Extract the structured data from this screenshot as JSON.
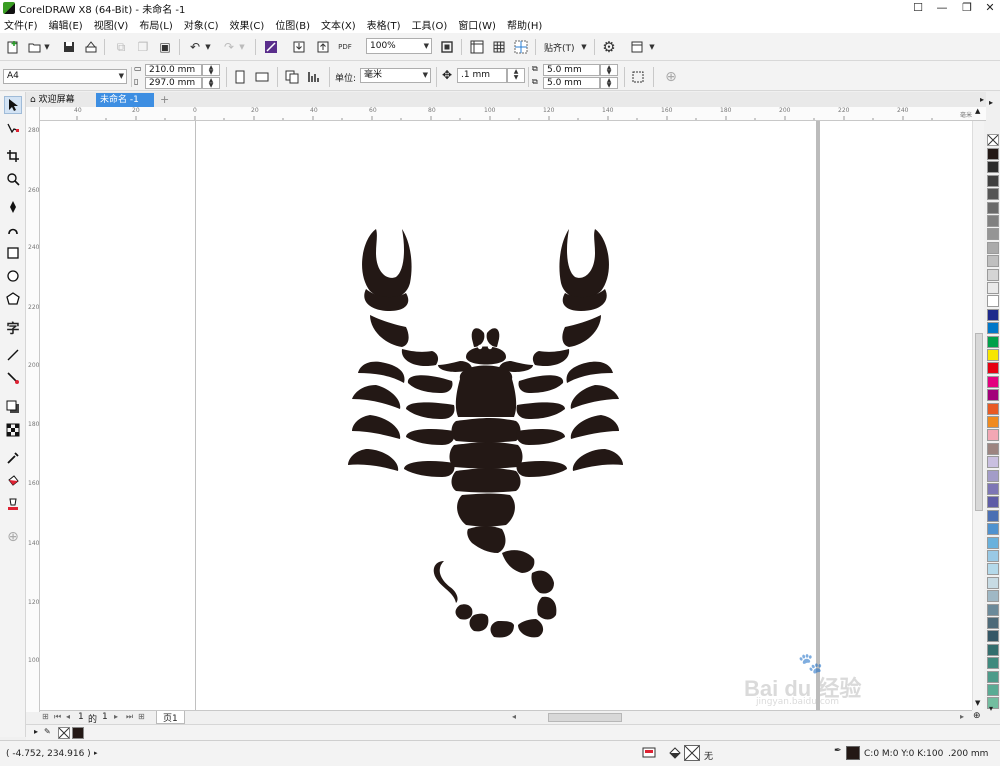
{
  "window": {
    "title": "CorelDRAW X8 (64-Bit) - 未命名 -1",
    "controls": {
      "user": "☐",
      "minimize": "—",
      "restore": "❐",
      "close": "✕"
    }
  },
  "menu": [
    "文件(F)",
    "编辑(E)",
    "视图(V)",
    "布局(L)",
    "对象(C)",
    "效果(C)",
    "位图(B)",
    "文本(X)",
    "表格(T)",
    "工具(O)",
    "窗口(W)",
    "帮助(H)"
  ],
  "toolbar_standard": {
    "pdf_label": "PDF",
    "zoom": "100%",
    "snap_label": "贴齐(T)"
  },
  "property_bar": {
    "page_size": "A4",
    "width": "210.0 mm",
    "height": "297.0 mm",
    "units_label": "单位:",
    "units_value": "毫米",
    "nudge": ".1 mm",
    "dup_x": "5.0 mm",
    "dup_y": "5.0 mm"
  },
  "tabs": {
    "welcome": "欢迎屏幕",
    "document": "未命名 -1",
    "close_glyph": "×",
    "add_glyph": "+"
  },
  "ruler_h": [
    "40",
    "20",
    "0",
    "20",
    "40",
    "60",
    "80",
    "100",
    "120",
    "140",
    "160",
    "180",
    "200",
    "220",
    "240"
  ],
  "ruler_v": [
    "280",
    "260",
    "240",
    "220",
    "200",
    "180",
    "160",
    "140",
    "120",
    "100",
    "80",
    "60",
    "40"
  ],
  "ruler_unit": "毫米",
  "page_nav": {
    "current": "1",
    "of_label": "的",
    "total": "1",
    "page_tab": "页1"
  },
  "status": {
    "cursor_coords": "( -4.752, 234.916 )",
    "fill_none_label": "无",
    "outline_color": "C:0 M:0 Y:0 K:100",
    "outline_width": ".200 mm"
  },
  "watermark": {
    "brand": "Bai du 经验",
    "url": "jingyan.baidu.com"
  },
  "colors": {
    "accent": "#3d8ee2",
    "artwork": "#231815",
    "palette": [
      "#231815",
      "#2b2b2b",
      "#3f3f3f",
      "#555555",
      "#6a6a6a",
      "#808080",
      "#959595",
      "#aaaaaa",
      "#bfbfbf",
      "#d4d4d4",
      "#e9e9e9",
      "#ffffff",
      "#1e2a8c",
      "#0077c8",
      "#00a04a",
      "#f7e600",
      "#e60012",
      "#e4007f",
      "#a2007a",
      "#e85a24",
      "#f08a1e",
      "#f2a7b4",
      "#9c8480",
      "#c9bfe0",
      "#a39cc8",
      "#7d76b5",
      "#5e5ca6",
      "#4b6fb3",
      "#4f92cf",
      "#69b1dc",
      "#99c9e5",
      "#b4d9ea",
      "#c7dbe4",
      "#9fb8c5",
      "#6b8a9a",
      "#4c6978",
      "#355766",
      "#336e6e",
      "#3f8a7e",
      "#4d9b8a",
      "#5aab94",
      "#73bda0"
    ]
  }
}
